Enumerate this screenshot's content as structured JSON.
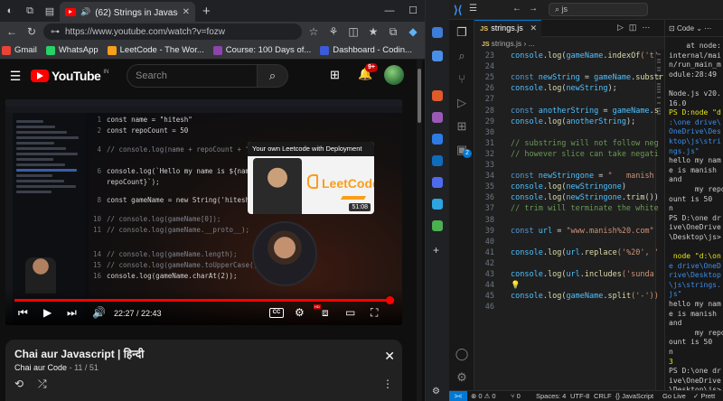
{
  "browser": {
    "tab_title": "(62) Strings in Javascript | दृ",
    "url": "https://www.youtube.com/watch?v=fozw",
    "bookmarks": [
      {
        "label": "Gmail",
        "color": "#ea4335"
      },
      {
        "label": "WhatsApp",
        "color": "#25d366"
      },
      {
        "label": "LeetCode - The Wor...",
        "color": "#f89f1b"
      },
      {
        "label": "Course: 100 Days of...",
        "color": "#8e44ad"
      },
      {
        "label": "Dashboard - Codin...",
        "color": "#3b5bdb"
      }
    ],
    "other_favorites": "Other favorites"
  },
  "youtube": {
    "logo_text": "YouTube",
    "country_code": "IN",
    "search_placeholder": "Search",
    "notification_count": "9+"
  },
  "video": {
    "inner_code": [
      {
        "n": "1",
        "html": "const name = \"hitesh\""
      },
      {
        "n": "2",
        "html": "const repoCount = 50"
      },
      {
        "n": "4",
        "html": "// console.log(name + repoCount + \" Value\");"
      },
      {
        "n": "6",
        "html": "console.log(`Hello my name is ${name} and my repo count is ${"
      },
      {
        "n": "",
        "html": "repoCount}`);"
      },
      {
        "n": "8",
        "html": "const gameName = new String('hitesh-hc-com')"
      },
      {
        "n": "10",
        "html": "// console.log(gameName[0]);"
      },
      {
        "n": "11",
        "html": "// console.log(gameName.__proto__);"
      },
      {
        "n": "14",
        "html": "// console.log(gameName.length);"
      },
      {
        "n": "15",
        "html": "// console.log(gameName.toUpperCase());"
      },
      {
        "n": "16",
        "html": "console.log(gameName.charAt(2));"
      }
    ],
    "card_title": "Your own Leetcode with Deployment",
    "card_logo": "LeetCode",
    "card_duration": "51:08",
    "current_time": "22:27",
    "total_time": "22:43",
    "time_display": "22:27 / 22:43",
    "progress_fraction": 0.988,
    "cc_label": "CC",
    "hd_label": "HD"
  },
  "playlist": {
    "title": "Chai aur Javascript | हिन्दी",
    "channel": "Chai aur Code",
    "position": "11 / 51"
  },
  "vscode": {
    "title_search": "js",
    "tab": "strings.js",
    "breadcrumb": "strings.js",
    "terminal_tab": "Code",
    "lines": [
      {
        "n": "23",
        "parts": [
          [
            "console",
            "c-var"
          ],
          [
            ".",
            ""
          ],
          [
            "log",
            "c-fn"
          ],
          [
            "(",
            ""
          ],
          [
            "gameName",
            "c-var"
          ],
          [
            ".",
            ""
          ],
          [
            "indexOf",
            "c-fn"
          ],
          [
            "('t'",
            "c-str"
          ]
        ]
      },
      {
        "n": "24",
        "parts": []
      },
      {
        "n": "25",
        "parts": [
          [
            "const ",
            "c-kw"
          ],
          [
            "newString",
            "c-var"
          ],
          [
            " = ",
            ""
          ],
          [
            "gameName",
            "c-var"
          ],
          [
            ".",
            ""
          ],
          [
            "substr",
            "c-fn"
          ]
        ]
      },
      {
        "n": "26",
        "parts": [
          [
            "console",
            "c-var"
          ],
          [
            ".",
            ""
          ],
          [
            "log",
            "c-fn"
          ],
          [
            "(",
            ""
          ],
          [
            "newString",
            "c-var"
          ],
          [
            ");",
            ""
          ]
        ]
      },
      {
        "n": "27",
        "parts": []
      },
      {
        "n": "28",
        "parts": [
          [
            "const ",
            "c-kw"
          ],
          [
            "anotherString",
            "c-var"
          ],
          [
            " = ",
            ""
          ],
          [
            "gameName",
            "c-var"
          ],
          [
            ".",
            ""
          ],
          [
            "s",
            "c-fn"
          ]
        ]
      },
      {
        "n": "29",
        "parts": [
          [
            "console",
            "c-var"
          ],
          [
            ".",
            ""
          ],
          [
            "log",
            "c-fn"
          ],
          [
            "(",
            ""
          ],
          [
            "anotherString",
            "c-var"
          ],
          [
            ");",
            ""
          ]
        ]
      },
      {
        "n": "30",
        "parts": []
      },
      {
        "n": "31",
        "parts": [
          [
            "// substring will not follow neg",
            "c-cmt"
          ]
        ]
      },
      {
        "n": "32",
        "parts": [
          [
            "// however slice can take negati",
            "c-cmt"
          ]
        ]
      },
      {
        "n": "33",
        "parts": []
      },
      {
        "n": "34",
        "parts": [
          [
            "const ",
            "c-kw"
          ],
          [
            "newStringone",
            "c-var"
          ],
          [
            " = ",
            ""
          ],
          [
            "\"   manish",
            "c-str"
          ]
        ]
      },
      {
        "n": "35",
        "parts": [
          [
            "console",
            "c-var"
          ],
          [
            ".",
            ""
          ],
          [
            "log",
            "c-fn"
          ],
          [
            "(",
            ""
          ],
          [
            "newStringone",
            "c-var"
          ],
          [
            ")",
            ""
          ]
        ]
      },
      {
        "n": "36",
        "parts": [
          [
            "console",
            "c-var"
          ],
          [
            ".",
            ""
          ],
          [
            "log",
            "c-fn"
          ],
          [
            "(",
            ""
          ],
          [
            "newStringone",
            "c-var"
          ],
          [
            ".",
            ""
          ],
          [
            "trim",
            "c-fn"
          ],
          [
            "())",
            ""
          ]
        ]
      },
      {
        "n": "37",
        "parts": [
          [
            "// trim will terminate the white",
            "c-cmt"
          ]
        ]
      },
      {
        "n": "38",
        "parts": []
      },
      {
        "n": "39",
        "parts": [
          [
            "const ",
            "c-kw"
          ],
          [
            "url",
            "c-var"
          ],
          [
            " = ",
            ""
          ],
          [
            "\"www.manish%20.com\"",
            "c-str"
          ]
        ]
      },
      {
        "n": "40",
        "parts": []
      },
      {
        "n": "41",
        "parts": [
          [
            "console",
            "c-var"
          ],
          [
            ".",
            ""
          ],
          [
            "log",
            "c-fn"
          ],
          [
            "(",
            ""
          ],
          [
            "url",
            "c-var"
          ],
          [
            ".",
            ""
          ],
          [
            "replace",
            "c-fn"
          ],
          [
            "('%20', '",
            "c-str"
          ]
        ]
      },
      {
        "n": "42",
        "parts": []
      },
      {
        "n": "43",
        "parts": [
          [
            "console",
            "c-var"
          ],
          [
            ".",
            ""
          ],
          [
            "log",
            "c-fn"
          ],
          [
            "(",
            ""
          ],
          [
            "url",
            "c-var"
          ],
          [
            ".",
            ""
          ],
          [
            "includes",
            "c-fn"
          ],
          [
            "('sunda",
            "c-str"
          ]
        ]
      },
      {
        "n": "44",
        "parts": [
          [
            "💡",
            "c-yel"
          ]
        ]
      },
      {
        "n": "45",
        "parts": [
          [
            "console",
            "c-var"
          ],
          [
            ".",
            ""
          ],
          [
            "log",
            "c-fn"
          ],
          [
            "(",
            ""
          ],
          [
            "gameName",
            "c-var"
          ],
          [
            ".",
            ""
          ],
          [
            "split",
            "c-fn"
          ],
          [
            "('-'))",
            "c-str"
          ]
        ]
      },
      {
        "n": "46",
        "parts": []
      }
    ],
    "terminal": [
      [
        "    at node:",
        ""
      ],
      [
        "internal/mai",
        ""
      ],
      [
        "n/run_main_m",
        ""
      ],
      [
        "odule:28:49",
        ""
      ],
      [
        "",
        ""
      ],
      [
        "Node.js v20.",
        ""
      ],
      [
        "16.0",
        ""
      ],
      [
        "PS D:node \"d",
        "t-yel"
      ],
      [
        ":\\one drive\\",
        "t-blue"
      ],
      [
        "OneDrive\\Des",
        "t-blue"
      ],
      [
        "ktop\\js\\stri",
        "t-blue"
      ],
      [
        "ngs.js\"",
        "t-blue"
      ],
      [
        "hello my nam",
        ""
      ],
      [
        "e is manish",
        ""
      ],
      [
        "and",
        ""
      ],
      [
        "      my repoc",
        ""
      ],
      [
        "ount is 50",
        ""
      ],
      [
        "n",
        ""
      ],
      [
        "PS D:\\one dr",
        ""
      ],
      [
        "ive\\OneDrive",
        ""
      ],
      [
        "\\Desktop\\js>",
        ""
      ],
      [
        "",
        ""
      ],
      [
        " node \"d:\\on",
        "t-yel"
      ],
      [
        "e drive\\OneD",
        "t-blue"
      ],
      [
        "rive\\Desktop",
        "t-blue"
      ],
      [
        "\\js\\strings.",
        "t-blue"
      ],
      [
        "js\"",
        "t-blue"
      ],
      [
        "hello my nam",
        ""
      ],
      [
        "e is manish",
        ""
      ],
      [
        "and",
        ""
      ],
      [
        "      my repoc",
        ""
      ],
      [
        "ount is 50",
        ""
      ],
      [
        "n",
        ""
      ],
      [
        "3",
        "t-yel"
      ],
      [
        "PS D:\\one dr",
        ""
      ],
      [
        "ive\\OneDrive",
        ""
      ],
      [
        "\\Desktop\\js>",
        ""
      ]
    ],
    "status": {
      "remote": "><",
      "problems": "⊗ 0 ⚠ 0",
      "ports": "⑂ 0",
      "spaces": "Spaces: 4",
      "encoding": "UTF-8",
      "eol": "CRLF",
      "language": "{} JavaScript",
      "golive": "Go Live",
      "prettier": "✓ Prett"
    }
  }
}
